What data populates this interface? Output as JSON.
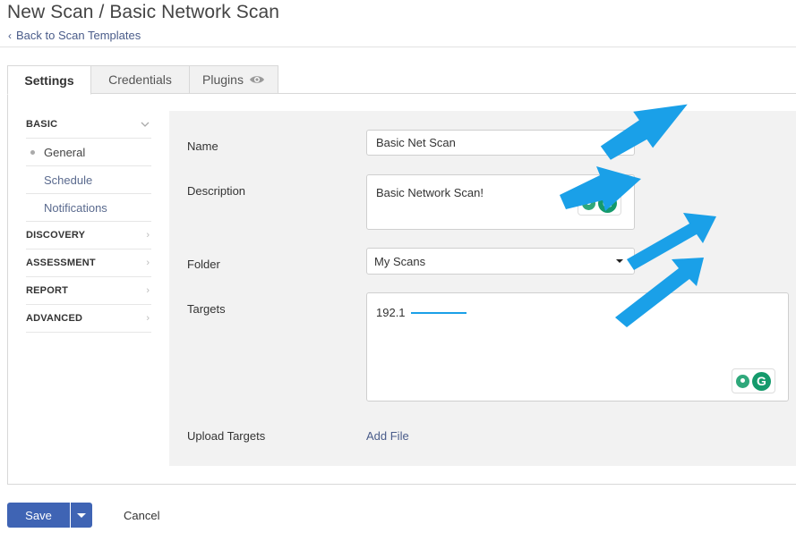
{
  "header": {
    "title": "New Scan / Basic Network Scan",
    "back_link": "Back to Scan Templates"
  },
  "tabs": [
    {
      "label": "Settings",
      "active": true
    },
    {
      "label": "Credentials",
      "active": false
    },
    {
      "label": "Plugins",
      "active": false,
      "icon": "eye-icon"
    }
  ],
  "sidebar": {
    "sections": [
      {
        "label": "BASIC",
        "expanded": true,
        "items": [
          "General",
          "Schedule",
          "Notifications"
        ]
      },
      {
        "label": "DISCOVERY"
      },
      {
        "label": "ASSESSMENT"
      },
      {
        "label": "REPORT"
      },
      {
        "label": "ADVANCED"
      }
    ]
  },
  "form": {
    "name_label": "Name",
    "name_value": "Basic Net Scan",
    "description_label": "Description",
    "description_value": "Basic Network Scan!",
    "folder_label": "Folder",
    "folder_value": "My Scans",
    "targets_label": "Targets",
    "targets_value": "192.1",
    "upload_label": "Upload Targets",
    "add_file": "Add File"
  },
  "footer": {
    "save": "Save",
    "cancel": "Cancel"
  },
  "colors": {
    "primary": "#3f64b4",
    "link": "#4a5c8a",
    "annotation_arrow": "#1aa0e8",
    "grammarly": "#159a6c"
  }
}
